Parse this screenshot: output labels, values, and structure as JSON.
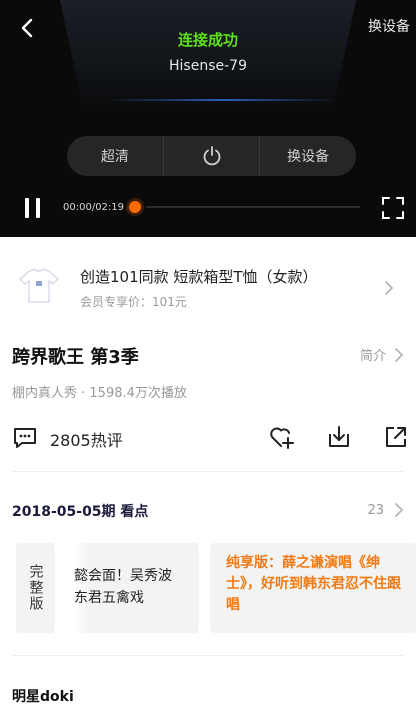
{
  "player": {
    "status": "连接成功",
    "device": "Hisense-79",
    "switch_top": "换设备",
    "controls": [
      "超清",
      "",
      "换设备"
    ],
    "time_current": "00:00",
    "time_total": "02:19",
    "time_display": "00:00/02:19",
    "progress": 0,
    "accent_color": "#ff6a00",
    "status_color": "#5fe01a"
  },
  "product": {
    "title": "创造101同款 短款箱型T恤（女款）",
    "price": "会员专享价：101元"
  },
  "show": {
    "title": "跨界歌王 第3季",
    "intro_label": "简介",
    "meta": "棚内真人秀 · 1598.4万次播放",
    "comment_count": "2805热评"
  },
  "episodes": {
    "date_label": "2018-05-05期 看点",
    "count": "23",
    "full_label": "完整版",
    "card_ep_line1": "懿会面！吴秀波",
    "card_ep_line2": "东君五禽戏",
    "card_hl_text": "纯享版：薛之谦演唱《绅士》，好听到韩东君忍不住跟唱"
  },
  "section": {
    "doki_title": "明星doki"
  }
}
